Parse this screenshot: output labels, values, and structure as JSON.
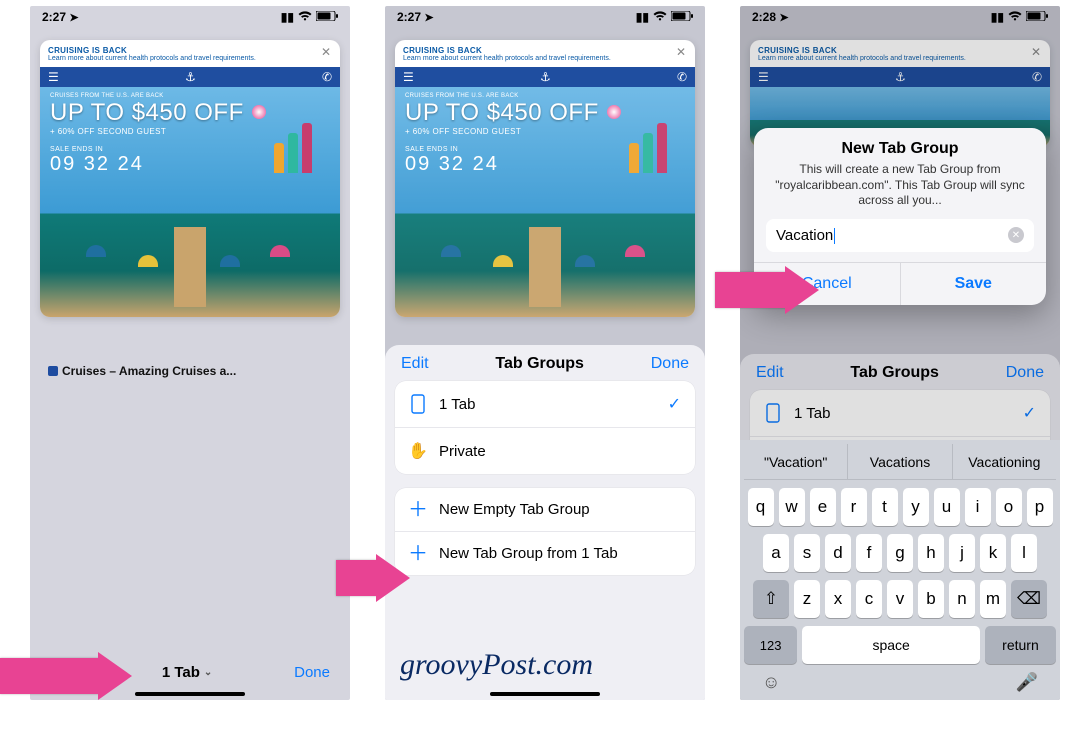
{
  "status": {
    "time1": "2:27",
    "time2": "2:27",
    "time3": "2:28"
  },
  "banner": {
    "title": "CRUISING IS BACK",
    "subtitle": "Learn more about current health protocols and travel requirements.",
    "tiny": "CRUISES FROM THE U.S. ARE BACK",
    "big": "UP TO $450 OFF",
    "off": "+ 60% OFF SECOND GUEST",
    "ends": "SALE ENDS IN",
    "counter": "09 32 24"
  },
  "phone1": {
    "tab_caption": "Cruises – Amazing Cruises a...",
    "tab_count": "1 Tab",
    "done": "Done"
  },
  "sheet": {
    "edit": "Edit",
    "title": "Tab Groups",
    "done": "Done",
    "rows": {
      "one_tab": "1 Tab",
      "private": "Private",
      "new_empty": "New Empty Tab Group",
      "new_from": "New Tab Group from 1 Tab"
    }
  },
  "dialog": {
    "title": "New Tab Group",
    "body": "This will create a new Tab Group from \"royalcaribbean.com\". This Tab Group will sync across all you...",
    "input": "Vacation",
    "cancel": "Cancel",
    "save": "Save"
  },
  "suggestions": {
    "s1": "\"Vacation\"",
    "s2": "Vacations",
    "s3": "Vacationing"
  },
  "keyboard": {
    "r1": [
      "q",
      "w",
      "e",
      "r",
      "t",
      "y",
      "u",
      "i",
      "o",
      "p"
    ],
    "r2": [
      "a",
      "s",
      "d",
      "f",
      "g",
      "h",
      "j",
      "k",
      "l"
    ],
    "r3": [
      "z",
      "x",
      "c",
      "v",
      "b",
      "n",
      "m"
    ],
    "num": "123",
    "space": "space",
    "return": "return"
  },
  "watermark": "groovyPost.com"
}
